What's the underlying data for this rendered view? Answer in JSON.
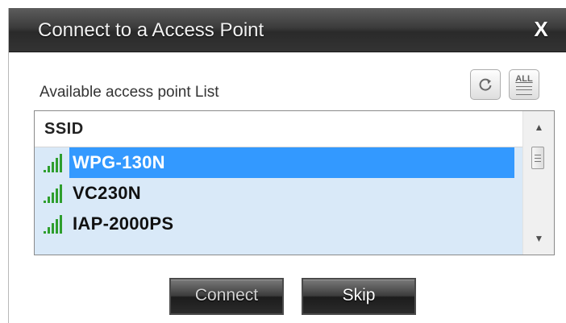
{
  "dialog": {
    "title": "Connect to a Access Point",
    "close_label": "X"
  },
  "toolbar": {
    "caption": "Available access point List",
    "refresh_icon": "refresh-icon",
    "select_all_label": "ALL"
  },
  "list": {
    "column_header": "SSID",
    "selected_index": 0,
    "items": [
      {
        "ssid": "WPG-130N",
        "signal_icon": "signal-strength-icon"
      },
      {
        "ssid": "VC230N",
        "signal_icon": "signal-strength-icon"
      },
      {
        "ssid": "IAP-2000PS",
        "signal_icon": "signal-strength-icon"
      }
    ]
  },
  "scrollbar": {
    "up_arrow": "▲",
    "down_arrow": "▼"
  },
  "buttons": {
    "connect": "Connect",
    "skip": "Skip"
  },
  "colors": {
    "selection": "#3399ff",
    "list_background": "#d9e9f8",
    "signal_bars": "#2e9e2e"
  }
}
